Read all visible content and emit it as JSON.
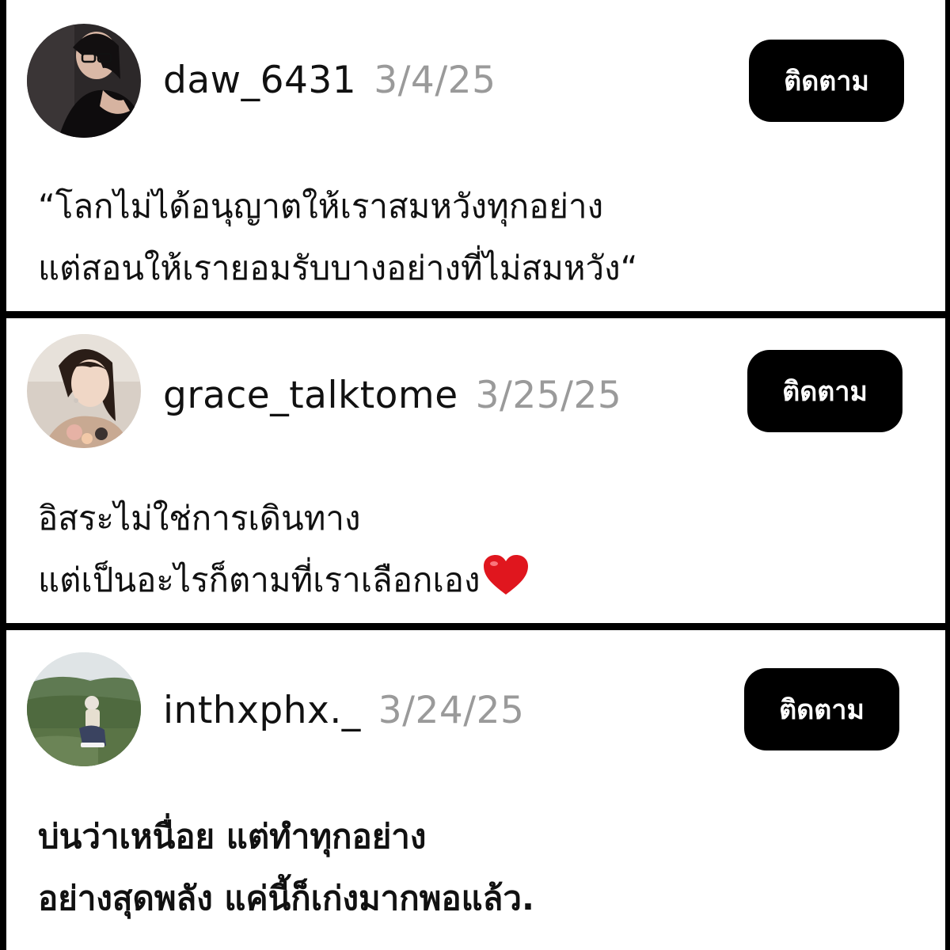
{
  "posts": [
    {
      "username": "daw_6431",
      "date": "3/4/25",
      "follow_label": "ติดตาม",
      "lines": [
        "“โลกไม่ได้อนุญาตให้เราสมหวังทุกอย่าง",
        "แต่สอนให้เรายอมรับบางอย่างที่ไม่สมหวัง“"
      ]
    },
    {
      "username": "grace_talktome",
      "date": "3/25/25",
      "follow_label": "ติดตาม",
      "lines": [
        "อิสระไม่ใช่การเดินทาง",
        "แต่เป็นอะไรก็ตามที่เราเลือกเอง"
      ],
      "trailing_icon": "red-heart-icon"
    },
    {
      "username": "inthxphx._",
      "date": "3/24/25",
      "follow_label": "ติดตาม",
      "lines": [
        "บ่นว่าเหนื่อย แต่ทำทุกอย่าง",
        "อย่างสุดพลัง แค่นี้ก็เก่งมากพอแล้ว."
      ]
    }
  ],
  "colors": {
    "background": "#000000",
    "card": "#ffffff",
    "date_text": "#9a9a9a",
    "button": "#000000",
    "button_text": "#ffffff",
    "heart": "#e0161e"
  }
}
